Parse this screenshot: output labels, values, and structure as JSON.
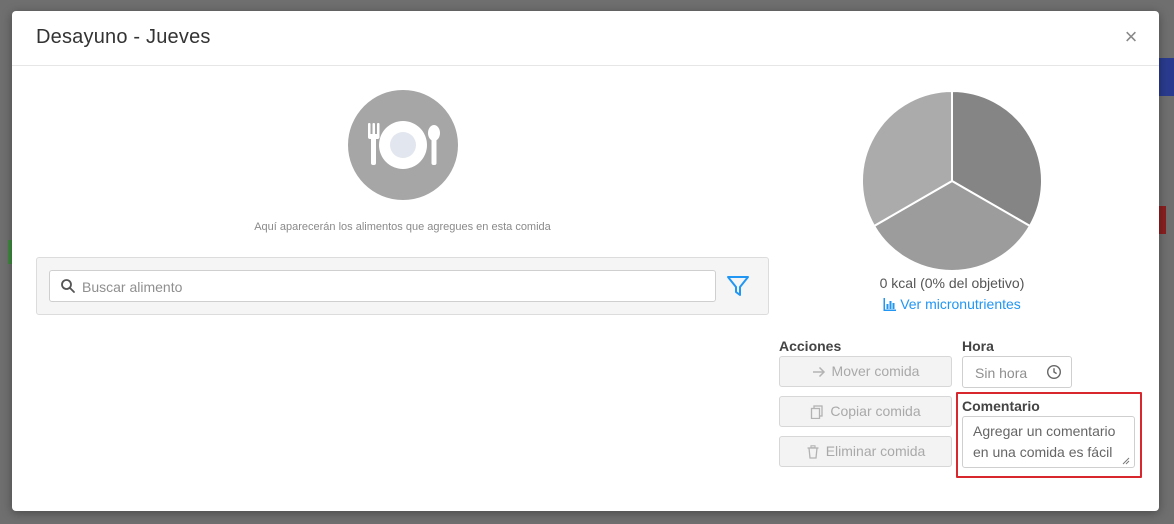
{
  "modal": {
    "title": "Desayuno - Jueves",
    "close_label": "×"
  },
  "empty_state": {
    "message": "Aquí aparecerán los alimentos que agregues en esta comida"
  },
  "search": {
    "placeholder": "Buscar alimento"
  },
  "summary": {
    "kcal_text": "0 kcal (0% del objetivo)",
    "micronutrients_link": "Ver micronutrientes",
    "pie_colors": [
      "#858585",
      "#9c9c9c",
      "#ababab"
    ]
  },
  "actions": {
    "label": "Acciones",
    "move_label": "Mover comida",
    "copy_label": "Copiar comida",
    "delete_label": "Eliminar comida"
  },
  "time": {
    "label": "Hora",
    "placeholder": "Sin hora"
  },
  "comment": {
    "label": "Comentario",
    "placeholder": "Agregar un comentario en una comida es fácil"
  },
  "colors": {
    "accent": "#2196f3",
    "highlight": "#d9272e"
  }
}
